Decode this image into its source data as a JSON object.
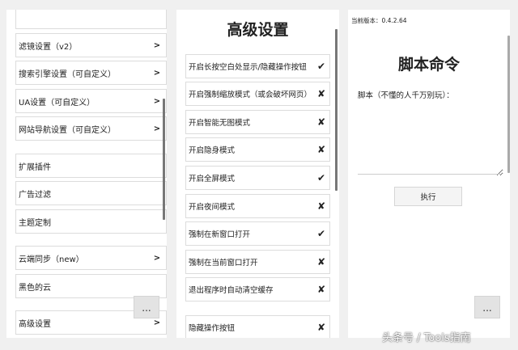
{
  "left_panel": {
    "items": [
      {
        "label": "",
        "chevron": ""
      },
      {
        "label": "滤镜设置（v2）",
        "chevron": ">"
      },
      {
        "label": "搜索引擎设置（可自定义）",
        "chevron": ">"
      },
      {
        "label": "UA设置（可自定义）",
        "chevron": ">"
      },
      {
        "label": "网站导航设置（可自定义）",
        "chevron": ">"
      },
      {
        "label": "扩展插件",
        "chevron": ""
      },
      {
        "label": "广告过滤",
        "chevron": ""
      },
      {
        "label": "主题定制",
        "chevron": ""
      },
      {
        "label": "云端同步（new）",
        "chevron": ">"
      },
      {
        "label": "黑色的云",
        "chevron": ""
      },
      {
        "label": "高级设置",
        "chevron": ">"
      }
    ],
    "more_button": "..."
  },
  "middle_panel": {
    "title": "高级设置",
    "items": [
      {
        "label": "开启长按空白处显示/隐藏操作按钮",
        "mark": "✔"
      },
      {
        "label": "开启强制缩放模式（或会破坏网页）",
        "mark": "✘"
      },
      {
        "label": "开启智能无图模式",
        "mark": "✘"
      },
      {
        "label": "开启隐身模式",
        "mark": "✘"
      },
      {
        "label": "开启全屏模式",
        "mark": "✔"
      },
      {
        "label": "开启夜间模式",
        "mark": "✘"
      },
      {
        "label": "强制在新窗口打开",
        "mark": "✔"
      },
      {
        "label": "强制在当前窗口打开",
        "mark": "✘"
      },
      {
        "label": "退出程序时自动清空缓存",
        "mark": "✘"
      },
      {
        "label": "隐藏操作按钮",
        "mark": "✘"
      }
    ]
  },
  "right_panel": {
    "version": "当前版本：0.4.2.64",
    "title": "脚本命令",
    "script_label": "脚本（不懂的人千万别玩）：",
    "script_value": "",
    "execute_button": "执行",
    "more_button": "..."
  },
  "watermark": "头条号 / Tools指南"
}
